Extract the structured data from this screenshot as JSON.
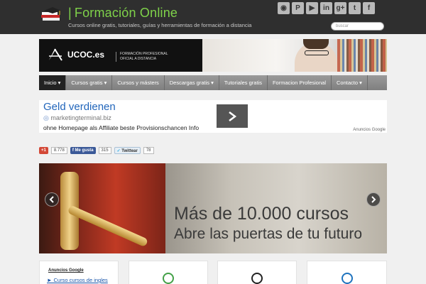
{
  "header": {
    "title": "Formación Online",
    "tagline": "Cursos online gratis, tutoriales, guías y herramientas de formación a distancia",
    "search_placeholder": "buscar",
    "social": [
      {
        "icon": "rss-icon",
        "glyph": "◉"
      },
      {
        "icon": "pinterest-icon",
        "glyph": "P"
      },
      {
        "icon": "youtube-icon",
        "glyph": "▶"
      },
      {
        "icon": "linkedin-icon",
        "glyph": "in"
      },
      {
        "icon": "googleplus-icon",
        "glyph": "g+"
      },
      {
        "icon": "twitter-icon",
        "glyph": "t"
      },
      {
        "icon": "facebook-icon",
        "glyph": "f"
      }
    ]
  },
  "banner": {
    "brand": "UCOC.es",
    "subtitle_line1": "FORMACIÓN PROFESIONAL",
    "subtitle_line2": "OFICIAL A DISTANCIA"
  },
  "nav": {
    "items": [
      {
        "label": "Inicio ▾",
        "active": true
      },
      {
        "label": "Cursos gratis ▾"
      },
      {
        "label": "Cursos y másters"
      },
      {
        "label": "Descargas gratis ▾"
      },
      {
        "label": "Tutoriales gratis"
      },
      {
        "label": "Formacion Profesional"
      },
      {
        "label": "Contacto ▾"
      }
    ]
  },
  "ad": {
    "title": "Geld verdienen",
    "url": "marketingterminal.biz",
    "description": "ohne Homepage als Affiliate beste Provisionschancen Info",
    "attribution": "Anuncios Google"
  },
  "share": {
    "gplus_label": "+1",
    "gplus_count": "8.778",
    "fb_label": "Me gusta",
    "fb_count": "315",
    "tw_label": "Twittear",
    "tw_count": "78"
  },
  "slider": {
    "headline": "Más de 10.000 cursos",
    "subheadline": "Abre las puertas de tu futuro"
  },
  "sidebar": {
    "widget_title": "Anuncios Google",
    "link": "► Curso cursos de ingles"
  },
  "colors": {
    "accent": "#7fd24a",
    "nav_active": "#222222",
    "link": "#2266bb"
  }
}
